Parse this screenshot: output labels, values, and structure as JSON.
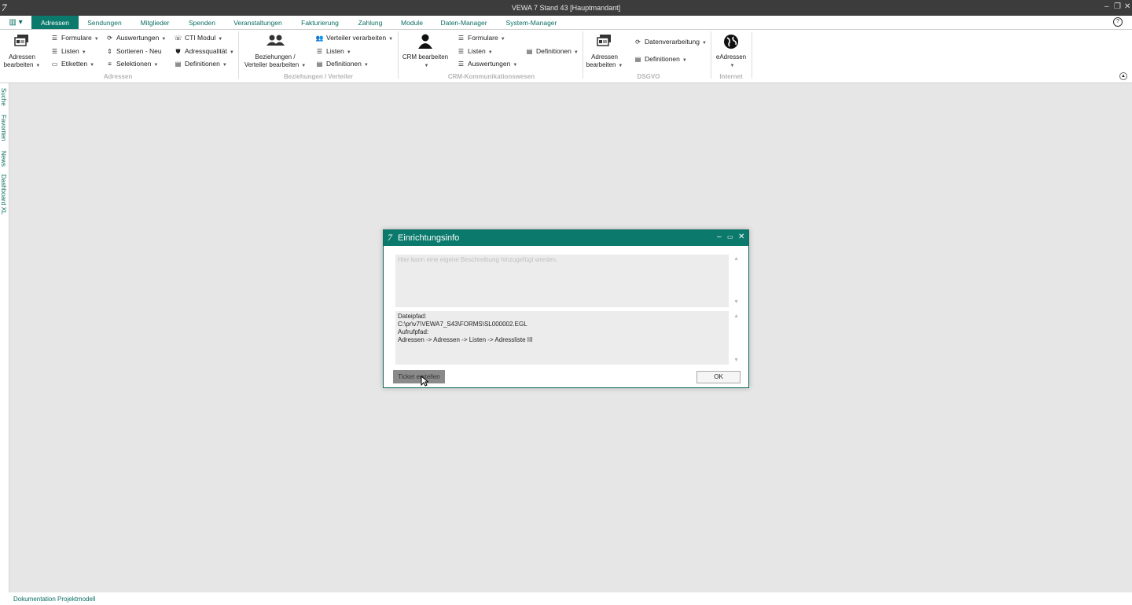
{
  "window": {
    "logo": "7",
    "title": "VEWA 7 Stand 43 [Hauptmandant]",
    "minimize": "–",
    "restore": "❐",
    "close": "✕"
  },
  "menu": {
    "app_button": "▥ ▾",
    "tabs": [
      {
        "label": "Adressen",
        "active": true
      },
      {
        "label": "Sendungen"
      },
      {
        "label": "Mitglieder"
      },
      {
        "label": "Spenden"
      },
      {
        "label": "Veranstaltungen"
      },
      {
        "label": "Fakturierung"
      },
      {
        "label": "Zahlung"
      },
      {
        "label": "Module"
      },
      {
        "label": "Daten-Manager"
      },
      {
        "label": "System-Manager"
      }
    ],
    "help": "?"
  },
  "ribbon": {
    "adressen": {
      "label": "Adressen",
      "big_button_line1": "Adressen",
      "big_button_line2": "bearbeiten",
      "items": [
        "Formulare",
        "Listen",
        "Etiketten",
        "Auswertungen",
        "Sortieren - Neu",
        "Selektionen",
        "CTI Modul",
        "Adressqualität",
        "Definitionen"
      ]
    },
    "beziehungen": {
      "label": "Beziehungen / Verteiler",
      "big_button_line1": "Beziehungen /",
      "big_button_line2": "Verteiler bearbeiten",
      "items": [
        "Verteiler verarbeiten",
        "Listen",
        "Definitionen"
      ]
    },
    "crm": {
      "label": "CRM-Kommunikationswesen",
      "big_button_line1": "CRM bearbeiten",
      "items": [
        "Formulare",
        "Listen",
        "Auswertungen",
        "Definitionen"
      ]
    },
    "dsgvo": {
      "label": "DSGVO",
      "big_button_line1": "Adressen",
      "big_button_line2": "bearbeiten",
      "items": [
        "Datenverarbeitung",
        "Definitionen"
      ]
    },
    "internet": {
      "label": "Internet",
      "big_button_line1": "eAdressen"
    }
  },
  "sidebar": {
    "items": [
      "Suche",
      "Favoriten",
      "News",
      "Dashboard XL"
    ]
  },
  "dialog": {
    "title": "Einrichtungsinfo",
    "description_placeholder": "Hier kann eine eigene Beschreibung hinzugefügt werden.",
    "filepath_label": "Dateipfad:",
    "filepath_value": "C:\\pr\\v7\\VEWA7_S43\\FORMS\\SL000002.EGL",
    "callpath_label": "Aufrufpfad:",
    "callpath_value": "Adressen -> Adressen -> Listen -> Adressliste III",
    "ticket_button": "Ticket erstellen",
    "ok_button": "OK"
  },
  "statusbar": {
    "link": "Dokumentation Projektmodell"
  }
}
